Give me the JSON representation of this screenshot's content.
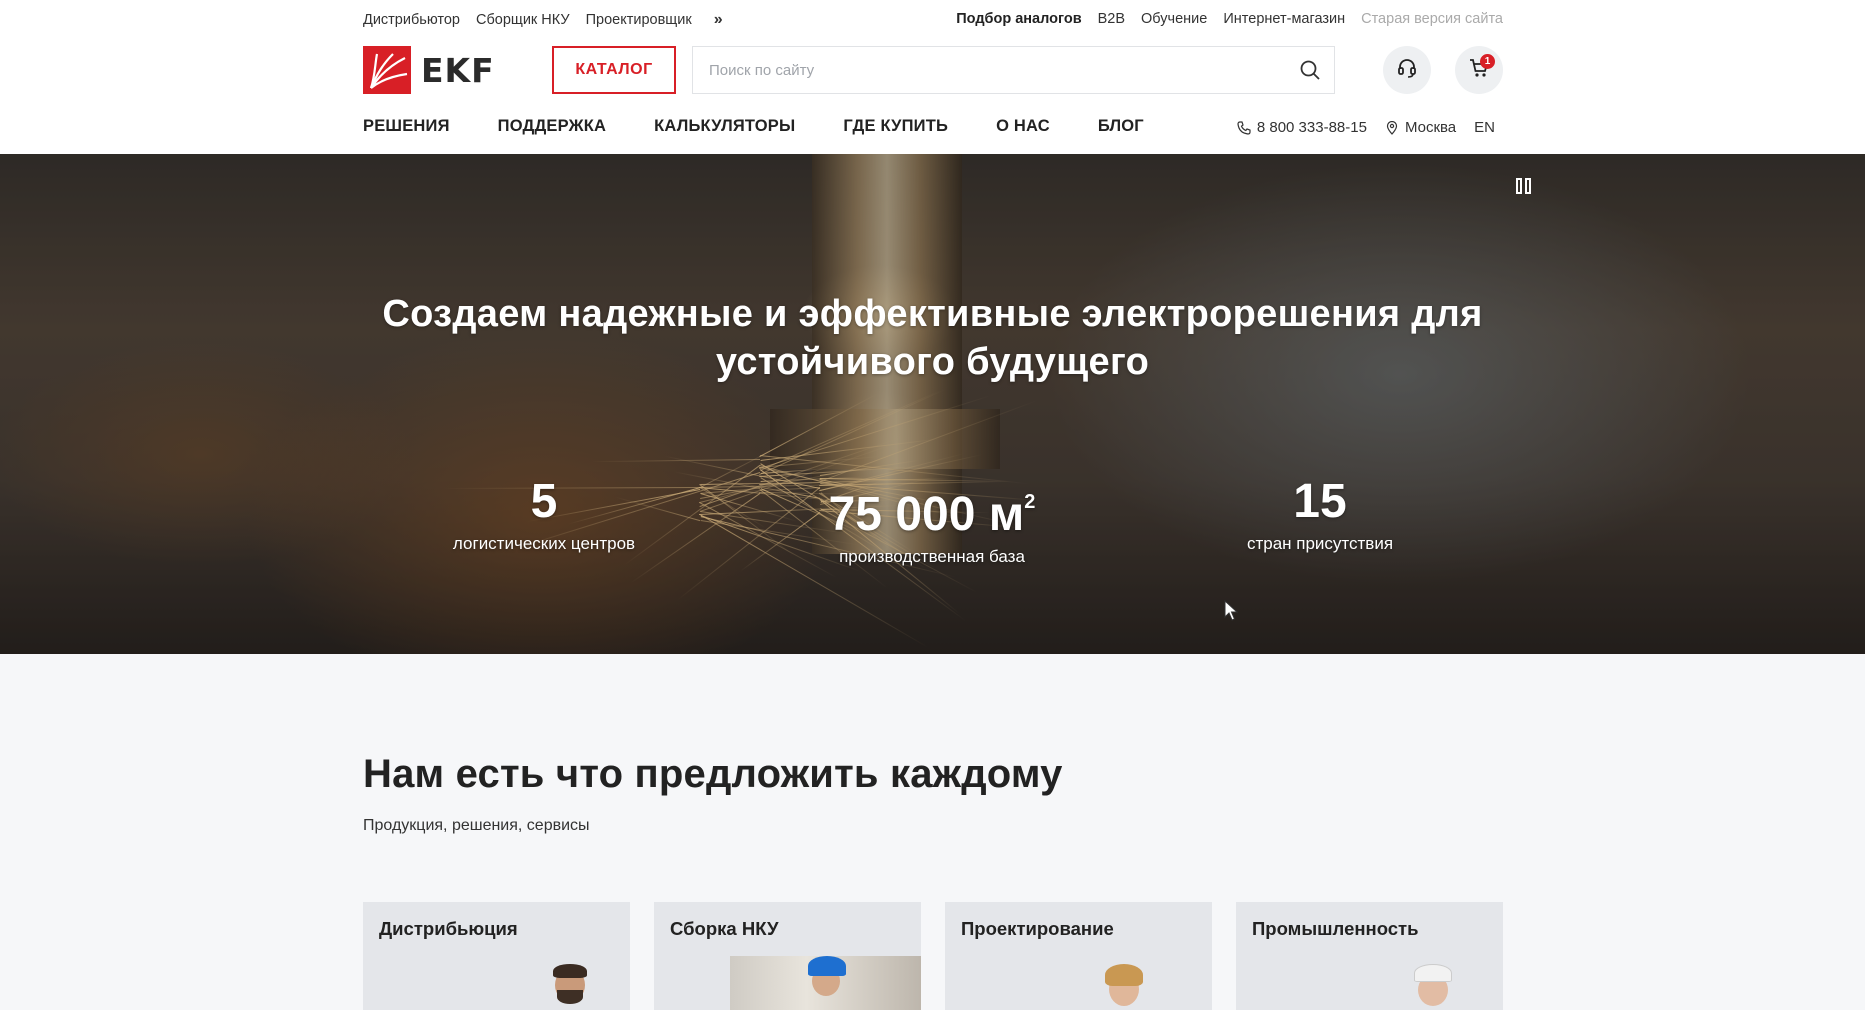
{
  "topbar": {
    "left_links": [
      "Дистрибьютор",
      "Сборщик НКУ",
      "Проектировщик"
    ],
    "more_icon": "double-chevron-right-icon",
    "more_glyph": "»",
    "right_links": [
      {
        "label": "Подбор аналогов",
        "style": "bold"
      },
      {
        "label": "B2B",
        "style": "normal"
      },
      {
        "label": "Обучение",
        "style": "normal"
      },
      {
        "label": "Интернет-магазин",
        "style": "normal"
      },
      {
        "label": "Старая версия сайта",
        "style": "muted"
      }
    ]
  },
  "header": {
    "logo_text": "EKF",
    "catalog_label": "КАТАЛОГ",
    "search_placeholder": "Поиск по сайту",
    "search_value": "",
    "cart_count": "1",
    "brand_color": "#d81f26"
  },
  "nav": {
    "items": [
      "РЕШЕНИЯ",
      "ПОДДЕРЖКА",
      "КАЛЬКУЛЯТОРЫ",
      "ГДЕ КУПИТЬ",
      "О НАС",
      "БЛОГ"
    ],
    "phone": "8 800 333-88-15",
    "city": "Москва",
    "lang": "EN"
  },
  "hero": {
    "title": "Создаем надежные и эффективные электрорешения для устойчивого будущего",
    "stats": [
      {
        "value": "5",
        "unit": "",
        "label": "логистических центров"
      },
      {
        "value": "75 000 м",
        "unit": "2",
        "label": "производственная база"
      },
      {
        "value": "15",
        "unit": "",
        "label": "стран присутствия"
      }
    ]
  },
  "offer": {
    "title": "Нам есть что предложить каждому",
    "subtitle": "Продукция, решения, сервисы",
    "cards": [
      {
        "title": "Дистрибьюция"
      },
      {
        "title": "Сборка НКУ"
      },
      {
        "title": "Проектирование"
      },
      {
        "title": "Промышленность"
      }
    ]
  }
}
